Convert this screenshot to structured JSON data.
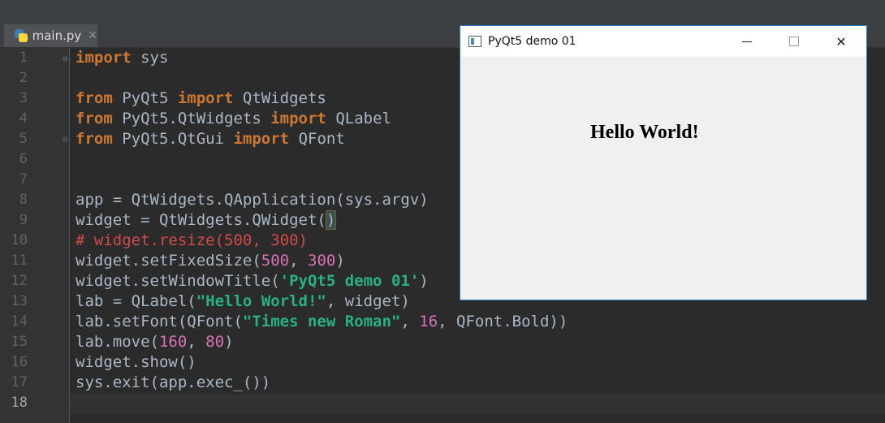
{
  "editor": {
    "tab": {
      "filename": "main.py",
      "close_glyph": "✕"
    },
    "current_line": 18,
    "line_numbers": [
      "1",
      "2",
      "3",
      "4",
      "5",
      "6",
      "7",
      "8",
      "9",
      "10",
      "11",
      "12",
      "13",
      "14",
      "15",
      "16",
      "17",
      "18"
    ],
    "code_lines": [
      "import sys",
      "",
      "from PyQt5 import QtWidgets",
      "from PyQt5.QtWidgets import QLabel",
      "from PyQt5.QtGui import QFont",
      "",
      "",
      "app = QtWidgets.QApplication(sys.argv)",
      "widget = QtWidgets.QWidget()",
      "# widget.resize(500, 300)",
      "widget.setFixedSize(500, 300)",
      "widget.setWindowTitle('PyQt5 demo 01')",
      "lab = QLabel(\"Hello World!\", widget)",
      "lab.setFont(QFont(\"Times new Roman\", 16, QFont.Bold))",
      "lab.move(160, 80)",
      "widget.show()",
      "sys.exit(app.exec_())",
      ""
    ]
  },
  "qt_window": {
    "title": "PyQt5 demo 01",
    "label_text": "Hello World!",
    "icons": {
      "app": "qt-window-icon",
      "minimize": "minimize-icon",
      "maximize": "maximize-icon",
      "close": "close-icon"
    },
    "close_glyph": "✕"
  },
  "colors": {
    "editor_bg": "#2b2b2b",
    "keyword": "#cc7832",
    "string": "#27b187",
    "number": "#d872b6",
    "comment": "#d24b4b",
    "window_border": "#2b7ec8"
  }
}
